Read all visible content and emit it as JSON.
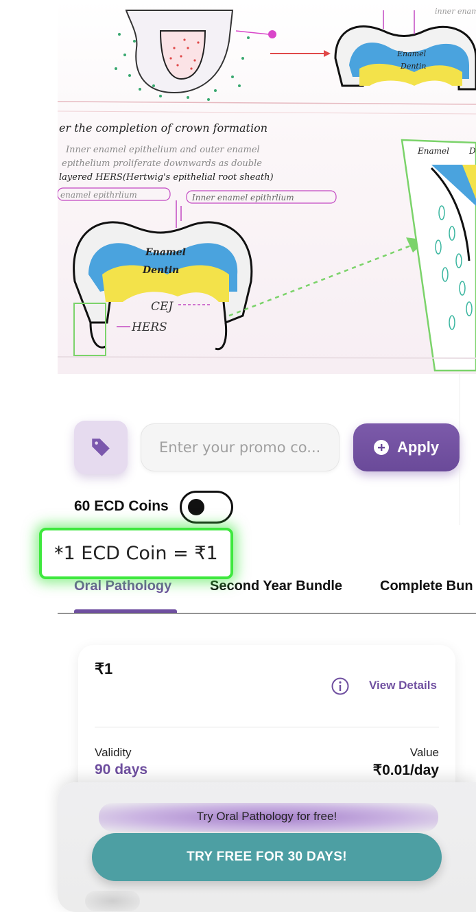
{
  "illustration": {
    "heading": "er the completion of crown formation",
    "note_line1": "Inner enamel epithelium and outer enamel",
    "note_line2": "epithelium proliferate downwards as double",
    "note_line3": "layered HERS(Hertwig's epithelial root sheath)",
    "label_outer": "enamel epithrlium",
    "label_inner": "Inner enamel epithrlium",
    "label_enamel": "Enamel",
    "label_dentin": "Dentin",
    "label_cej": "CEJ",
    "label_hers": "HERS",
    "top_enamel": "Enamel",
    "top_dentin": "Dentin",
    "side_enamel": "Enamel",
    "side_d": "D",
    "top_corner": "inner enamel"
  },
  "promo": {
    "placeholder": "Enter your promo co...",
    "apply_label": "Apply"
  },
  "coins": {
    "label": "60 ECD Coins",
    "note": "*1 ECD Coin = ₹1"
  },
  "tabs": [
    {
      "label": "Oral Pathology"
    },
    {
      "label": "Second Year Bundle"
    },
    {
      "label": "Complete Bun"
    }
  ],
  "plan": {
    "price": "₹1",
    "view_details": "View Details",
    "validity_label": "Validity",
    "validity_value": "90 days",
    "value_label": "Value",
    "value_value": "₹0.01/day"
  },
  "cta": {
    "trial_text": "Try Oral Pathology for free!",
    "button_label": "TRY FREE FOR 30 DAYS!"
  },
  "colors": {
    "accent": "#6f4fa0",
    "cta": "#4d9fa3",
    "highlight": "#3ee83e"
  }
}
